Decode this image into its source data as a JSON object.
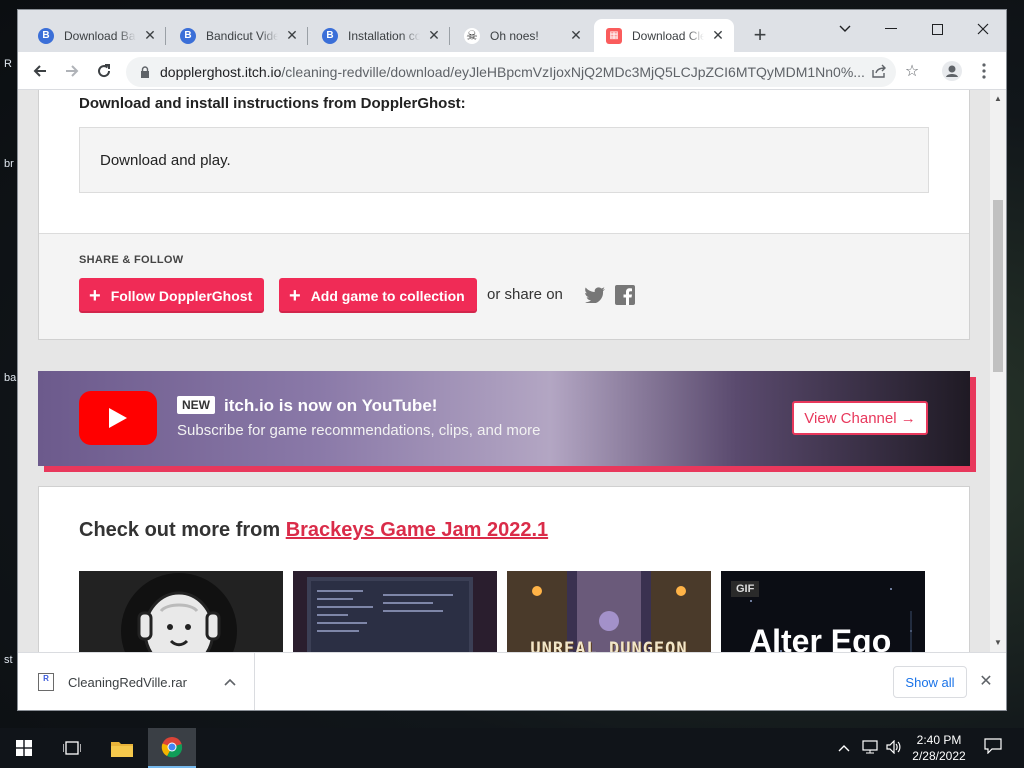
{
  "desktop": {
    "labels": [
      "R",
      "br",
      "ba",
      "st"
    ]
  },
  "browser": {
    "tabs": [
      {
        "title": "Download Bandicut",
        "favicon": "B",
        "color": "#3b6fd8"
      },
      {
        "title": "Bandicut Video Cutter",
        "favicon": "B",
        "color": "#3b6fd8"
      },
      {
        "title": "Installation complete",
        "favicon": "B",
        "color": "#3b6fd8"
      },
      {
        "title": "Oh noes!",
        "favicon": "☠",
        "color": "#333333"
      },
      {
        "title": "Download Cleaning RedVille",
        "favicon": "▦",
        "color": "#fa5c5c"
      }
    ],
    "new_tab_label": "+",
    "url_host": "dopplerghost.itch.io",
    "url_path": "/cleaning-redville/download/eyJleHBpcmVzIjoxNjQ2MDc3MjQ5LCJpZCI6MTQyMDM1Nn0%..."
  },
  "page": {
    "instructions_title": "Download and install instructions from DopplerGhost:",
    "instructions_text": "Download and play.",
    "share_label": "SHARE & FOLLOW",
    "follow_button": "Follow DopplerGhost",
    "collection_button": "Add game to collection",
    "or_share": "or share on",
    "youtube": {
      "badge": "NEW",
      "headline": "itch.io is now on YouTube!",
      "subtitle": "Subscribe for game recommendations, clips, and more",
      "button": "View Channel →"
    },
    "more": {
      "prefix": "Check out more from ",
      "link": "Brackeys Game Jam 2022.1"
    },
    "thumbnails": [
      {
        "label": ""
      },
      {
        "label": ""
      },
      {
        "label": "UNREAL DUNGEON"
      },
      {
        "label": "Alter Ego",
        "badge": "GIF"
      }
    ]
  },
  "download_bar": {
    "file_name": "CleaningRedVille.rar",
    "show_all": "Show all"
  },
  "taskbar": {
    "time": "2:40 PM",
    "date": "2/28/2022"
  },
  "colors": {
    "itch_red": "#f02b56",
    "link_red": "#da2c49",
    "youtube_red": "#ff0000"
  }
}
